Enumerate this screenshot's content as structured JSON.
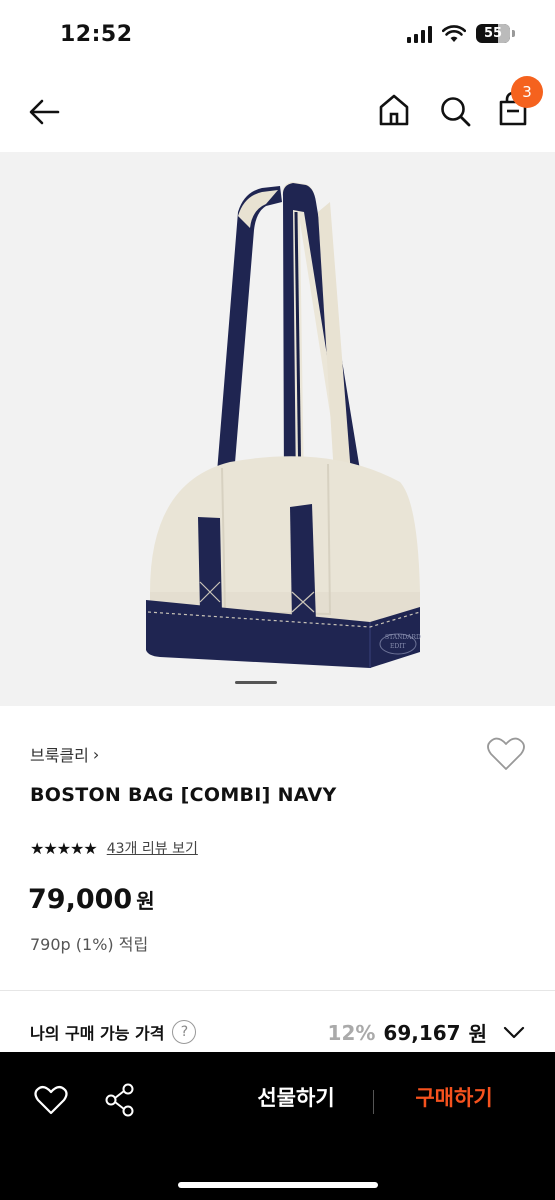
{
  "status_bar": {
    "time": "12:52",
    "battery": "55",
    "icons": [
      "cellular-signal-icon",
      "wifi-icon",
      "battery-icon"
    ]
  },
  "nav": {
    "icons": [
      "back-arrow-icon",
      "home-icon",
      "search-icon",
      "shopping-bag-icon"
    ],
    "cart_count": "3"
  },
  "hero": {
    "image": "product-photo-boston-bag",
    "logo_text": "STANDARD EDIT"
  },
  "product": {
    "brand": "브룩클리",
    "brand_chevron": "›",
    "name": "BOSTON BAG [COMBI] NAVY",
    "stars": "★★★★★",
    "rating": 5,
    "review_link": "43개 리뷰 보기",
    "price": "79,000",
    "currency": "원",
    "points": "790p (1%) 적립"
  },
  "my_price": {
    "label": "나의 구매 가능 가격",
    "help": "?",
    "discount": "12%",
    "price": "69,167",
    "currency": "원"
  },
  "bottom_bar": {
    "gift_label": "선물하기",
    "buy_label": "구매하기",
    "colors": {
      "background": "#000000",
      "buy": "#f5521e"
    }
  },
  "colors": {
    "accent": "#f5621e",
    "hero_bg": "#f2f2f2"
  }
}
